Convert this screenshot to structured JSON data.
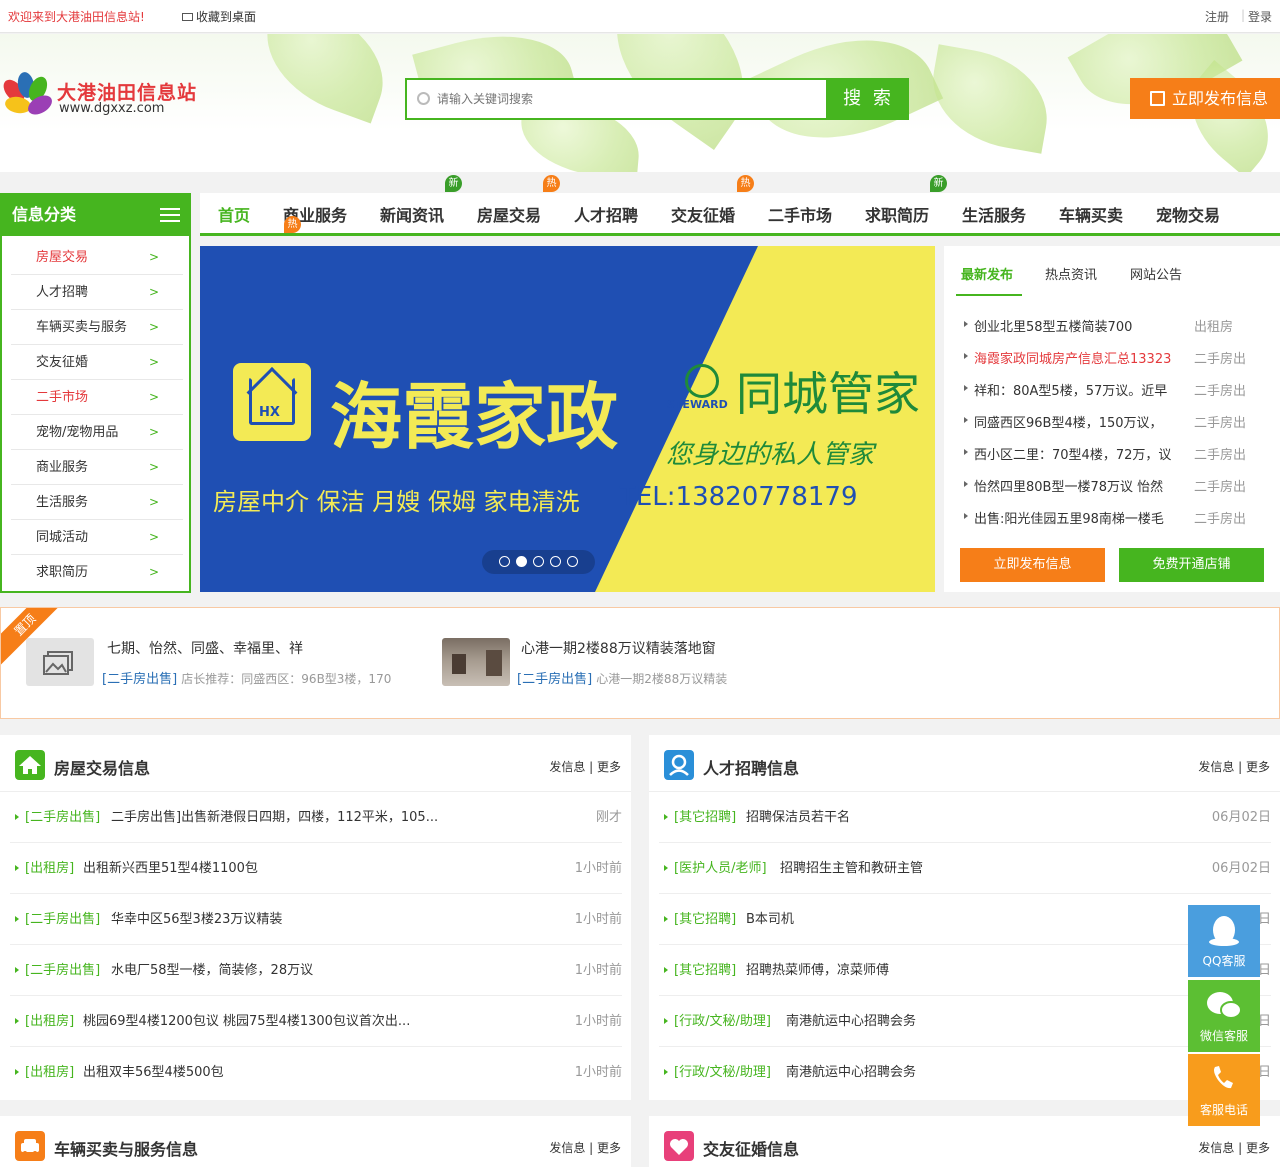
{
  "topbar": {
    "welcome": "欢迎来到大港油田信息站!",
    "favorite": "收藏到桌面",
    "register": "注册",
    "separator": "|",
    "login": "登录"
  },
  "logo": {
    "title": "大港油田信息站",
    "url": "www.dgxxz.com"
  },
  "search": {
    "placeholder": "请输入关键词搜索",
    "button": "搜 索"
  },
  "publish_button": "立即发布信息",
  "category_header": "信息分类",
  "nav": {
    "items": [
      {
        "label": "首页"
      },
      {
        "label": "商业服务",
        "badge": "热"
      },
      {
        "label": "新闻资讯"
      },
      {
        "label": "房屋交易",
        "badge": "新"
      },
      {
        "label": "人才招聘",
        "badge": "热"
      },
      {
        "label": "交友征婚"
      },
      {
        "label": "二手市场",
        "badge": "热"
      },
      {
        "label": "求职简历"
      },
      {
        "label": "生活服务",
        "badge": "新"
      },
      {
        "label": "车辆买卖"
      },
      {
        "label": "宠物交易"
      }
    ]
  },
  "categories": [
    {
      "label": "房屋交易"
    },
    {
      "label": "人才招聘"
    },
    {
      "label": "车辆买卖与服务"
    },
    {
      "label": "交友征婚"
    },
    {
      "label": "二手市场"
    },
    {
      "label": "宠物/宠物用品"
    },
    {
      "label": "商业服务"
    },
    {
      "label": "生活服务"
    },
    {
      "label": "同城活动"
    },
    {
      "label": "求职简历"
    }
  ],
  "banner": {
    "brand_left": "海霞家政",
    "logo_letters": "HX",
    "brand_right": "同城管家",
    "steward": "STEWARD",
    "slogan": "您身边的私人管家",
    "services": "房屋中介 保洁 月嫂 保姆 家电清洗",
    "tel": "TEL:13820778179"
  },
  "right_panel": {
    "tabs": [
      "最新发布",
      "热点资讯",
      "网站公告"
    ],
    "items": [
      {
        "title": "创业北里58型五楼简装700",
        "category": "出租房"
      },
      {
        "title": "海霞家政同城房产信息汇总13323",
        "category": "二手房出"
      },
      {
        "title": "祥和：80A型5楼，57万议。近早",
        "category": "二手房出"
      },
      {
        "title": "同盛西区96B型4楼，150万议，",
        "category": "二手房出"
      },
      {
        "title": "西小区二里：70型4楼，72万，议",
        "category": "二手房出"
      },
      {
        "title": "怡然四里80B型一楼78万议 怡然",
        "category": "二手房出"
      },
      {
        "title": "出售:阳光佳园五里98南梯一楼毛",
        "category": "二手房出"
      }
    ],
    "btn_publish": "立即发布信息",
    "btn_shop": "免费开通店铺"
  },
  "top_ads": {
    "ribbon": "置顶",
    "items": [
      {
        "title": "七期、怡然、同盛、幸福里、祥",
        "tag": "[二手房出售]",
        "desc": "店长推荐：同盛西区：96B型3楼，170"
      },
      {
        "title": "心港一期2楼88万议精装落地窗",
        "tag": "[二手房出售]",
        "desc": "心港一期2楼88万议精装"
      }
    ]
  },
  "sections": {
    "house": {
      "title": "房屋交易信息",
      "more": "发信息 | 更多",
      "rows": [
        {
          "tag": "[二手房出售]",
          "text": "二手房出售]出售新港假日四期，四楼，112平米，105...",
          "time": "刚才"
        },
        {
          "tag": "[出租房]",
          "text": "出租新兴西里51型4楼1100包",
          "time": "1小时前"
        },
        {
          "tag": "[二手房出售]",
          "text": "华幸中区56型3楼23万议精装",
          "time": "1小时前"
        },
        {
          "tag": "[二手房出售]",
          "text": "水电厂58型一楼，简装修，28万议",
          "time": "1小时前"
        },
        {
          "tag": "[出租房]",
          "text": "桃园69型4楼1200包议 桃园75型4楼1300包议首次出...",
          "time": "1小时前"
        },
        {
          "tag": "[出租房]",
          "text": "出租双丰56型4楼500包",
          "time": "1小时前"
        }
      ]
    },
    "jobs": {
      "title": "人才招聘信息",
      "more": "发信息 | 更多",
      "rows": [
        {
          "tag": "[其它招聘]",
          "text": "招聘保洁员若干名",
          "time": "06月02日"
        },
        {
          "tag": "[医护人员/老师]",
          "text": "招聘招生主管和教研主管",
          "time": "06月02日"
        },
        {
          "tag": "[其它招聘]",
          "text": "B本司机",
          "time": "06月02日"
        },
        {
          "tag": "[其它招聘]",
          "text": "招聘热菜师傅，凉菜师傅",
          "time": "06月02日"
        },
        {
          "tag": "[行政/文秘/助理]",
          "text": "南港航运中心招聘会务",
          "time": "06月02日"
        },
        {
          "tag": "[行政/文秘/助理]",
          "text": "南港航运中心招聘会务",
          "time": "06月02日"
        }
      ]
    },
    "cars": {
      "title": "车辆买卖与服务信息",
      "more": "发信息 | 更多"
    },
    "dating": {
      "title": "交友征婚信息",
      "more": "发信息 | 更多"
    }
  },
  "float_service": {
    "qq": "QQ客服",
    "wechat": "微信客服",
    "phone": "客服电话"
  },
  "colors": {
    "brand_green": "#46b51f",
    "accent_orange": "#f67e18",
    "alert_red": "#e4393c"
  }
}
